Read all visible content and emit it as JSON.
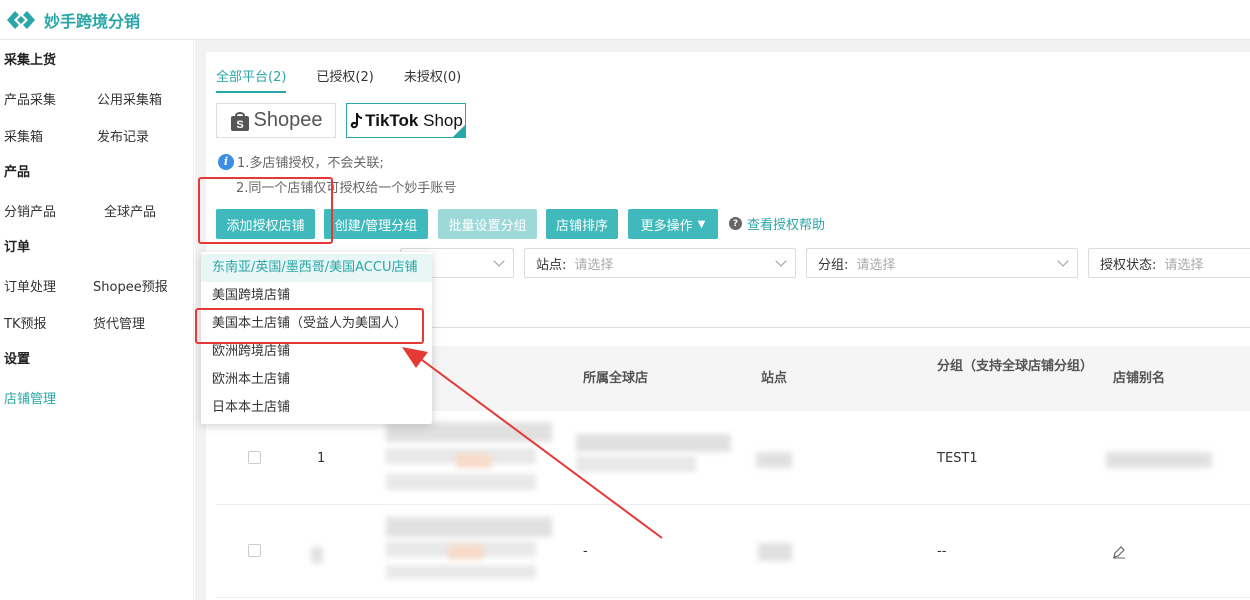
{
  "header": {
    "title": "妙手跨境分销"
  },
  "sidebar": {
    "sections": [
      {
        "title": "采集上货",
        "rows": [
          [
            "产品采集",
            "公用采集箱"
          ],
          [
            "采集箱",
            "发布记录"
          ]
        ]
      },
      {
        "title": "产品",
        "rows": [
          [
            "分销产品",
            "全球产品"
          ]
        ]
      },
      {
        "title": "订单",
        "rows": [
          [
            "订单处理",
            "Shopee预报"
          ],
          [
            "TK预报",
            "货代管理"
          ]
        ]
      },
      {
        "title": "设置",
        "rows": [
          [
            "店铺管理"
          ]
        ]
      }
    ]
  },
  "tabs": [
    "全部平台(2)",
    "已授权(2)",
    "未授权(0)"
  ],
  "platforms": {
    "shopee": "Shopee",
    "tiktok_main": "TikTok",
    "tiktok_sub": " Shop"
  },
  "tips": [
    "1.多店铺授权，不会关联;",
    "2.同一个店铺仅可授权给一个妙手账号"
  ],
  "buttons": {
    "add": "添加授权店铺",
    "group": "创建/管理分组",
    "batch": "批量设置分组",
    "sort": "店铺排序",
    "more": "更多操作",
    "help": "查看授权帮助"
  },
  "filters": {
    "site_label": "站点:",
    "group_label": "分组:",
    "auth_label": "授权状态:",
    "placeholder": "请选择"
  },
  "dropdown": [
    "东南亚/英国/墨西哥/美国ACCU店铺",
    "美国跨境店铺",
    "美国本土店铺（受益人为美国人）",
    "欧洲跨境店铺",
    "欧洲本土店铺",
    "日本本土店铺"
  ],
  "table": {
    "headers": {
      "global_store": "所属全球店",
      "site": "站点",
      "group": "分组（支持全球店铺分组）",
      "alias": "店铺别名"
    },
    "rows": [
      {
        "index": "1",
        "global_store": "",
        "group": "TEST1"
      },
      {
        "index": "",
        "global_store": "-",
        "group": "--"
      }
    ]
  },
  "colors": {
    "accent": "#2aa6a8",
    "button": "#3fb9bb",
    "annotation": "#e53935"
  }
}
